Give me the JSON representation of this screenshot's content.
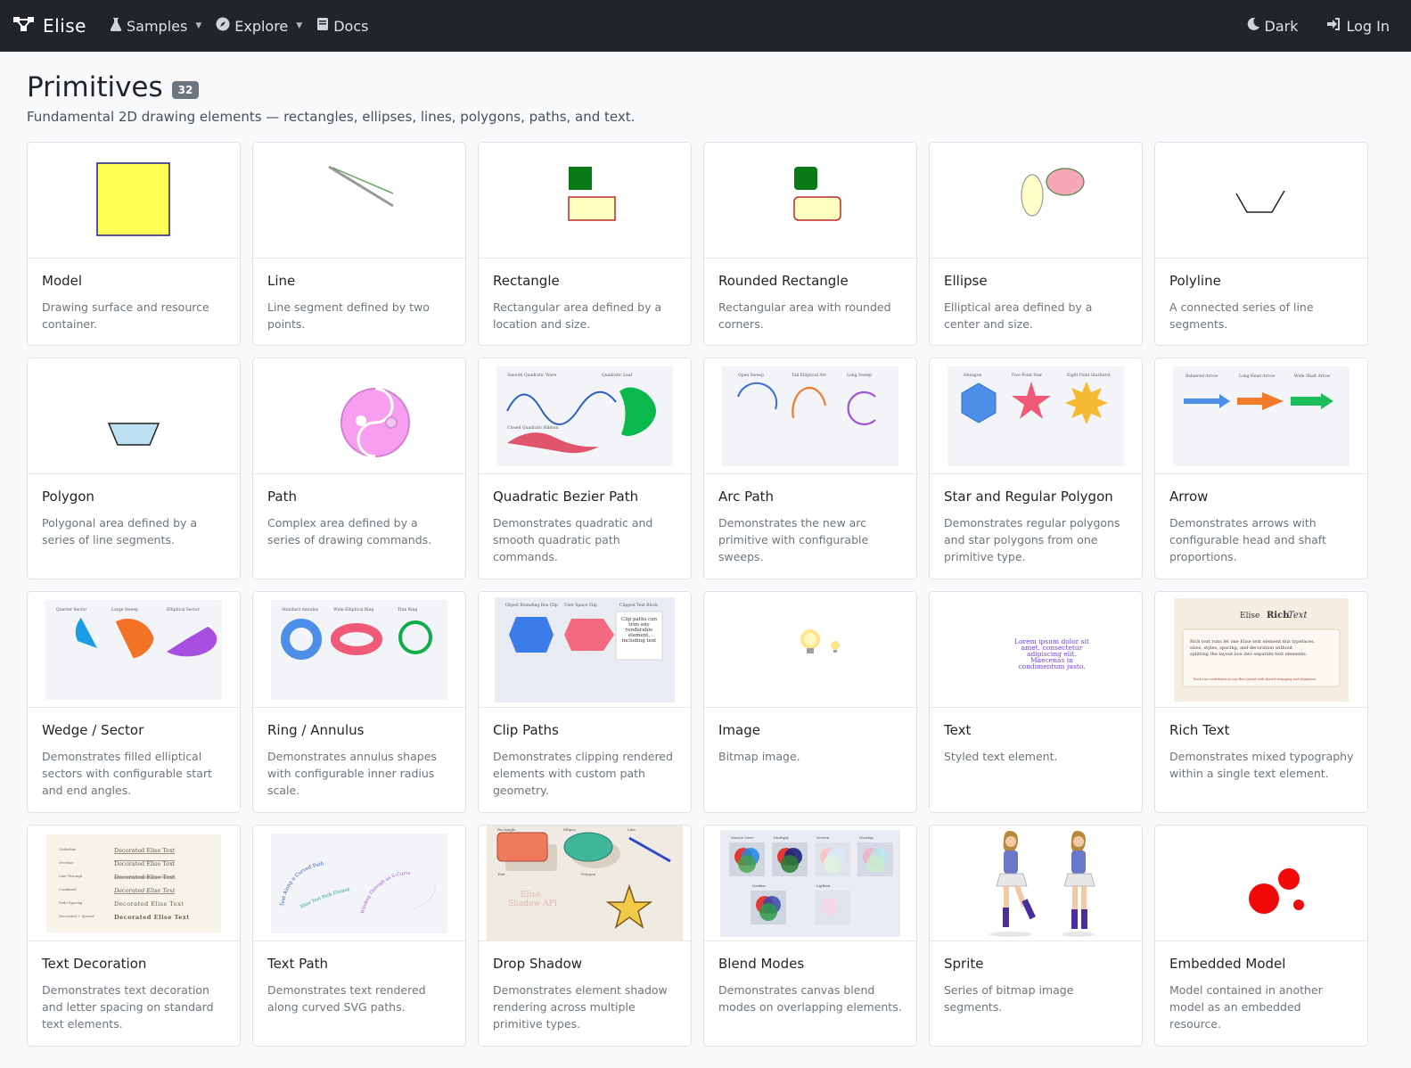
{
  "nav": {
    "brand": "Elise",
    "samples": "Samples",
    "explore": "Explore",
    "docs": "Docs",
    "dark": "Dark",
    "login": "Log In"
  },
  "page": {
    "title": "Primitives",
    "count": "32",
    "subtitle": "Fundamental 2D drawing elements — rectangles, ellipses, lines, polygons, paths, and text."
  },
  "cards": [
    {
      "title": "Model",
      "desc": "Drawing surface and resource container.",
      "icon": "model-thumbnail"
    },
    {
      "title": "Line",
      "desc": "Line segment defined by two points.",
      "icon": "line-thumbnail"
    },
    {
      "title": "Rectangle",
      "desc": "Rectangular area defined by a location and size.",
      "icon": "rectangle-thumbnail"
    },
    {
      "title": "Rounded Rectangle",
      "desc": "Rectangular area with rounded corners.",
      "icon": "rounded-rectangle-thumbnail"
    },
    {
      "title": "Ellipse",
      "desc": "Elliptical area defined by a center and size.",
      "icon": "ellipse-thumbnail"
    },
    {
      "title": "Polyline",
      "desc": "A connected series of line segments.",
      "icon": "polyline-thumbnail"
    },
    {
      "title": "Polygon",
      "desc": "Polygonal area defined by a series of line segments.",
      "icon": "polygon-thumbnail"
    },
    {
      "title": "Path",
      "desc": "Complex area defined by a series of drawing commands.",
      "icon": "path-thumbnail"
    },
    {
      "title": "Quadratic Bezier Path",
      "desc": "Demonstrates quadratic and smooth quadratic path commands.",
      "icon": "quadratic-bezier-thumbnail"
    },
    {
      "title": "Arc Path",
      "desc": "Demonstrates the new arc primitive with configurable sweeps.",
      "icon": "arc-path-thumbnail"
    },
    {
      "title": "Star and Regular Polygon",
      "desc": "Demonstrates regular polygons and star polygons from one primitive type.",
      "icon": "star-polygon-thumbnail"
    },
    {
      "title": "Arrow",
      "desc": "Demonstrates arrows with configurable head and shaft proportions.",
      "icon": "arrow-thumbnail"
    },
    {
      "title": "Wedge / Sector",
      "desc": "Demonstrates filled elliptical sectors with configurable start and end angles.",
      "icon": "wedge-thumbnail"
    },
    {
      "title": "Ring / Annulus",
      "desc": "Demonstrates annulus shapes with configurable inner radius scale.",
      "icon": "ring-thumbnail"
    },
    {
      "title": "Clip Paths",
      "desc": "Demonstrates clipping rendered elements with custom path geometry.",
      "icon": "clip-paths-thumbnail"
    },
    {
      "title": "Image",
      "desc": "Bitmap image.",
      "icon": "image-thumbnail"
    },
    {
      "title": "Text",
      "desc": "Styled text element.",
      "icon": "text-thumbnail"
    },
    {
      "title": "Rich Text",
      "desc": "Demonstrates mixed typography within a single text element.",
      "icon": "rich-text-thumbnail"
    },
    {
      "title": "Text Decoration",
      "desc": "Demonstrates text decoration and letter spacing on standard text elements.",
      "icon": "text-decoration-thumbnail"
    },
    {
      "title": "Text Path",
      "desc": "Demonstrates text rendered along curved SVG paths.",
      "icon": "text-path-thumbnail"
    },
    {
      "title": "Drop Shadow",
      "desc": "Demonstrates element shadow rendering across multiple primitive types.",
      "icon": "drop-shadow-thumbnail"
    },
    {
      "title": "Blend Modes",
      "desc": "Demonstrates canvas blend modes on overlapping elements.",
      "icon": "blend-modes-thumbnail"
    },
    {
      "title": "Sprite",
      "desc": "Series of bitmap image segments.",
      "icon": "sprite-thumbnail"
    },
    {
      "title": "Embedded Model",
      "desc": "Model contained in another model as an embedded resource.",
      "icon": "embedded-model-thumbnail"
    }
  ],
  "thumb_text": {
    "quad": {
      "a": "Smooth Quadratic Wave",
      "b": "Quadratic Leaf",
      "c": "Closed Quadratic Ribbon"
    },
    "arc": {
      "a": "Open Sweep",
      "b": "Tall Elliptical Arc",
      "c": "Long Sweep"
    },
    "star": {
      "a": "Hexagon",
      "b": "Five Point Star",
      "c": "Eight Point Starburst"
    },
    "arrow": {
      "a": "Balanced Arrow",
      "b": "Long Head Arrow",
      "c": "Wide Shaft Arrow"
    },
    "wedge": {
      "a": "Quarter Sector",
      "b": "Large Sweep",
      "c": "Elliptical Sector"
    },
    "ring": {
      "a": "Standard Annulus",
      "b": "Wide Elliptical Ring",
      "c": "Thin Ring"
    },
    "clip": {
      "a": "Object Bounding Box Clip",
      "b": "User Space Clip",
      "c": "Clipped Text Block",
      "d": "Clip paths can trim any renderable element, including text"
    },
    "text": {
      "a": "Lorem ipsum dolor sit",
      "b": "amet, consectetur",
      "c": "adipiscing elit.",
      "d": "Maecenas in",
      "e": "condimentum justo."
    },
    "rich": {
      "a": "Elise",
      "b": "Rich",
      "c": "Text",
      "d": "Rich text runs let one Elise text element mix typefaces,",
      "e": "sizes, styles, spacing, and decoration without",
      "f": "splitting the layout box into separate text elements.",
      "g": "Each run contributes to one flow layout with shared wrapping and alignment."
    },
    "deco": {
      "labels": [
        "Underline",
        "Overline",
        "Line Through",
        "Combined",
        "Wide Spacing",
        "Decorated + Spaced"
      ],
      "sample": "Decorated Elise Text"
    },
    "textpath": {
      "a": "Text Along a Curved Path",
      "b": "Elise Text Path Element",
      "c": "Winding Through an S-Curve"
    },
    "shadow": {
      "a": "Rectangle",
      "b": "Ellipse",
      "c": "Line",
      "d": "Text",
      "e": "Polygon",
      "f": "Elise",
      "g": "Shadow API"
    },
    "blend": {
      "a": "Source Over",
      "b": "Multiply",
      "c": "Screen",
      "d": "Overlay",
      "e": "Darken",
      "f": "Lighten"
    }
  }
}
